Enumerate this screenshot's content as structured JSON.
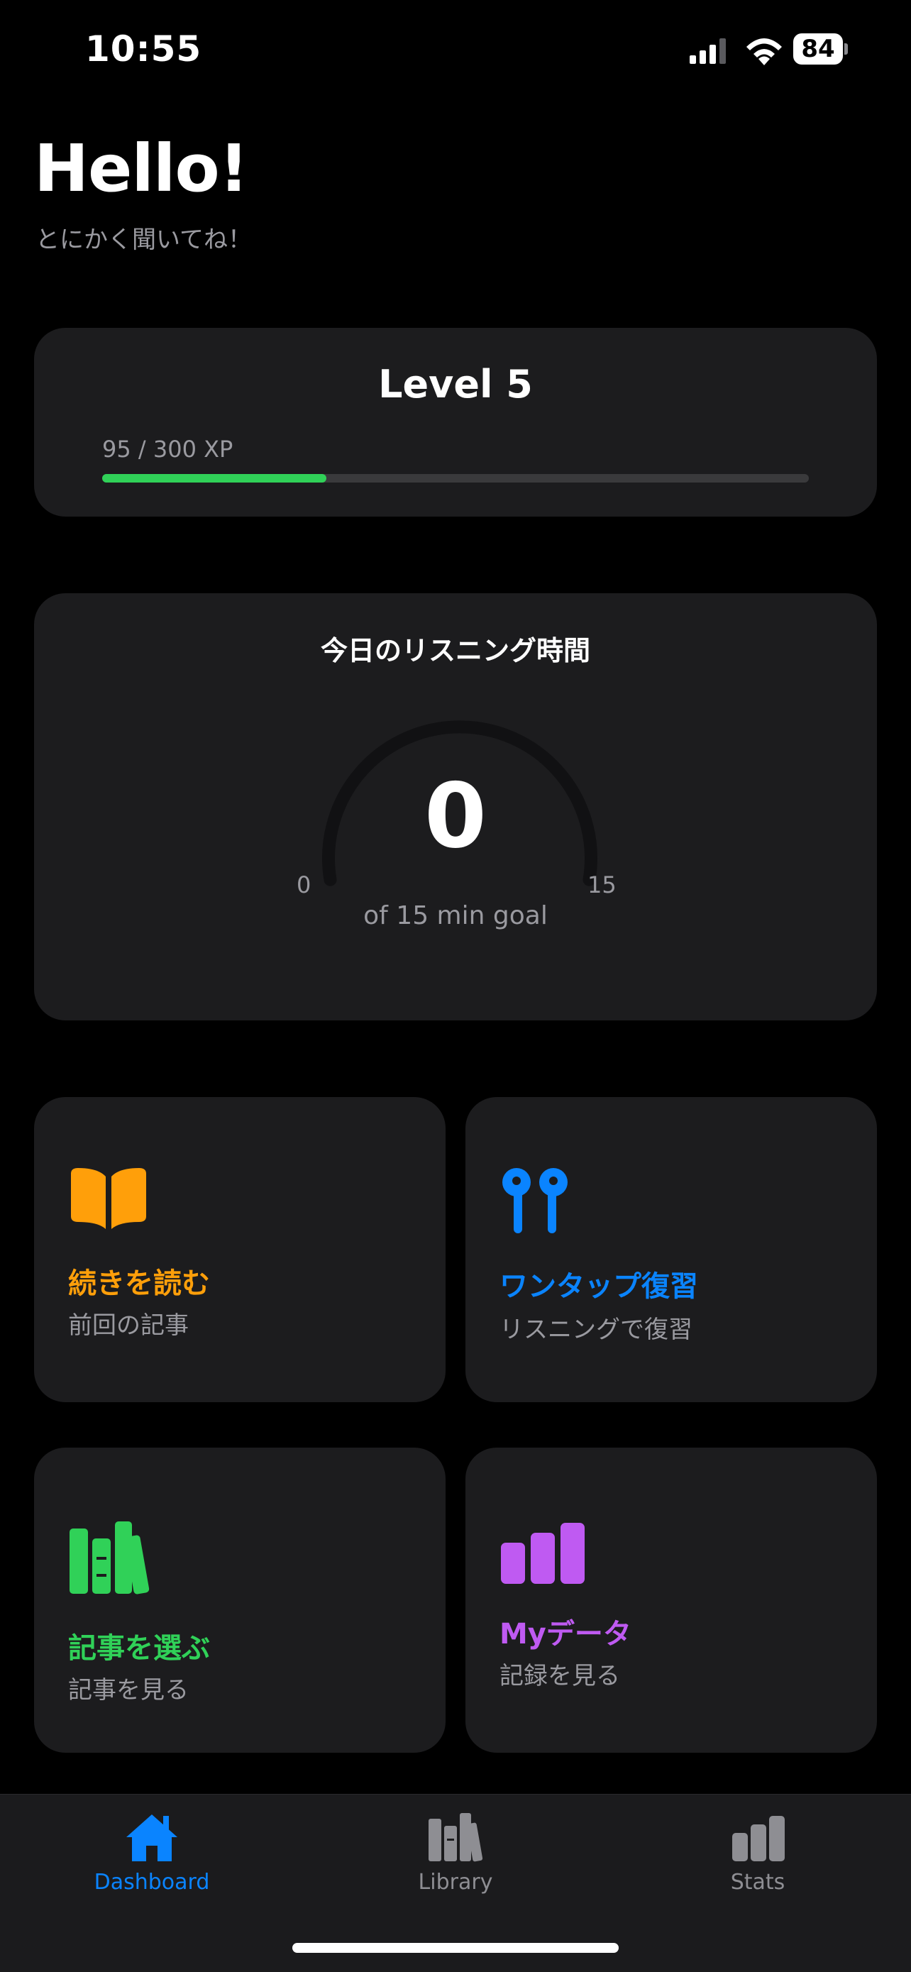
{
  "status": {
    "time": "10:55",
    "battery": "84"
  },
  "header": {
    "greeting": "Hello!",
    "subtitle": "とにかく聞いてね！"
  },
  "level": {
    "title": "Level 5",
    "xp_text": "95 / 300 XP",
    "xp_progress": 0.317,
    "progress_color": "#30d158"
  },
  "listening": {
    "title": "今日のリスニング時間",
    "value": "0",
    "min_label": "0",
    "max_label": "15",
    "goal_text": "of 15 min goal",
    "progress": 0
  },
  "tiles": [
    {
      "title": "続きを読む",
      "subtitle": "前回の記事",
      "icon": "open-book-icon",
      "color": "#ff9f0a"
    },
    {
      "title": "ワンタップ復習",
      "subtitle": "リスニングで復習",
      "icon": "earbuds-icon",
      "color": "#0a84ff"
    },
    {
      "title": "記事を選ぶ",
      "subtitle": "記事を見る",
      "icon": "books-icon",
      "color": "#30d158"
    },
    {
      "title": "Myデータ",
      "subtitle": "記録を見る",
      "icon": "bar-chart-icon",
      "color": "#bf5af2"
    }
  ],
  "tabs": [
    {
      "label": "Dashboard",
      "icon": "house-icon",
      "active": true,
      "color": "#0a84ff"
    },
    {
      "label": "Library",
      "icon": "books-icon",
      "active": false,
      "color": "#8e8e93"
    },
    {
      "label": "Stats",
      "icon": "bar-chart-icon",
      "active": false,
      "color": "#8e8e93"
    }
  ]
}
